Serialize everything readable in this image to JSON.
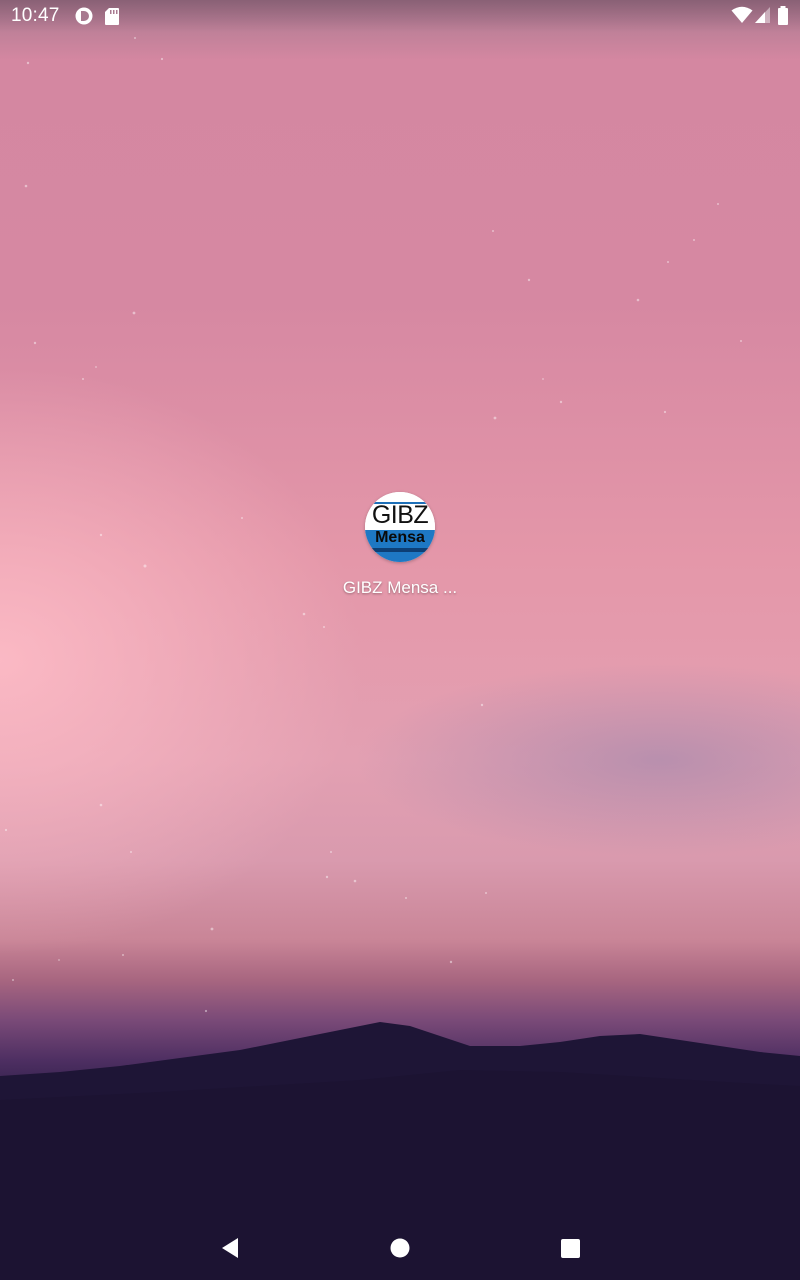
{
  "status_bar": {
    "time": "10:47",
    "left_icons": [
      "notification-app-icon",
      "sd-card-icon"
    ],
    "right_icons": [
      "wifi-icon",
      "cellular-signal-icon",
      "battery-icon"
    ]
  },
  "home_screen": {
    "apps": [
      {
        "label": "GIBZ Mensa ...",
        "icon": {
          "top_text": "GIBZ",
          "bottom_text": "Mensa",
          "colors": {
            "top": "#ffffff",
            "bottom": "#1e78c4",
            "band": "#0d3f75"
          }
        }
      }
    ]
  },
  "navigation_bar": {
    "buttons": [
      "back-icon",
      "home-icon",
      "recents-icon"
    ]
  }
}
